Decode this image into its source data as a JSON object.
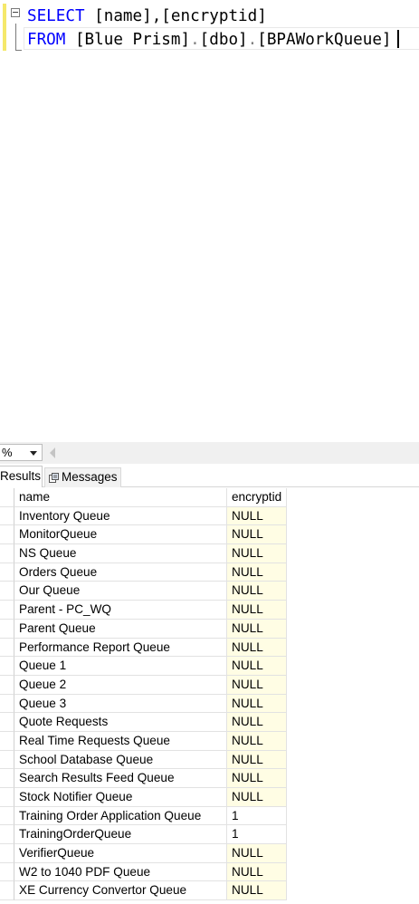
{
  "editor": {
    "line1": {
      "keyword": "SELECT",
      "text": " [name],[encryptid]"
    },
    "line2": {
      "keyword": "FROM",
      "text": " [Blue Prism]",
      "dot1": ".",
      "schema": "[dbo]",
      "dot2": ".",
      "table": "[BPAWorkQueue]"
    }
  },
  "zoom": {
    "value": "%"
  },
  "tabs": {
    "results": "Results",
    "messages": "Messages"
  },
  "grid": {
    "columns": {
      "name": "name",
      "encryptid": "encryptid"
    },
    "rows": [
      {
        "name": "Inventory Queue",
        "encryptid": "NULL"
      },
      {
        "name": "MonitorQueue",
        "encryptid": "NULL"
      },
      {
        "name": "NS Queue",
        "encryptid": "NULL"
      },
      {
        "name": "Orders Queue",
        "encryptid": "NULL"
      },
      {
        "name": "Our Queue",
        "encryptid": "NULL"
      },
      {
        "name": "Parent - PC_WQ",
        "encryptid": "NULL"
      },
      {
        "name": "Parent Queue",
        "encryptid": "NULL"
      },
      {
        "name": "Performance Report Queue",
        "encryptid": "NULL"
      },
      {
        "name": "Queue 1",
        "encryptid": "NULL"
      },
      {
        "name": "Queue 2",
        "encryptid": "NULL"
      },
      {
        "name": "Queue 3",
        "encryptid": "NULL"
      },
      {
        "name": "Quote Requests",
        "encryptid": "NULL"
      },
      {
        "name": "Real Time Requests Queue",
        "encryptid": "NULL"
      },
      {
        "name": "School Database Queue",
        "encryptid": "NULL"
      },
      {
        "name": "Search Results Feed Queue",
        "encryptid": "NULL"
      },
      {
        "name": "Stock Notifier Queue",
        "encryptid": "NULL"
      },
      {
        "name": "Training Order Application Queue",
        "encryptid": "1"
      },
      {
        "name": "TrainingOrderQueue",
        "encryptid": "1"
      },
      {
        "name": "VerifierQueue",
        "encryptid": "NULL"
      },
      {
        "name": "W2 to 1040 PDF Queue",
        "encryptid": "NULL"
      },
      {
        "name": "XE Currency Convertor Queue",
        "encryptid": "NULL"
      }
    ]
  },
  "colors": {
    "keyword": "#0000ff",
    "operator": "#808080",
    "null_bg": "#fffde4",
    "change_bar": "#f5e86a"
  }
}
